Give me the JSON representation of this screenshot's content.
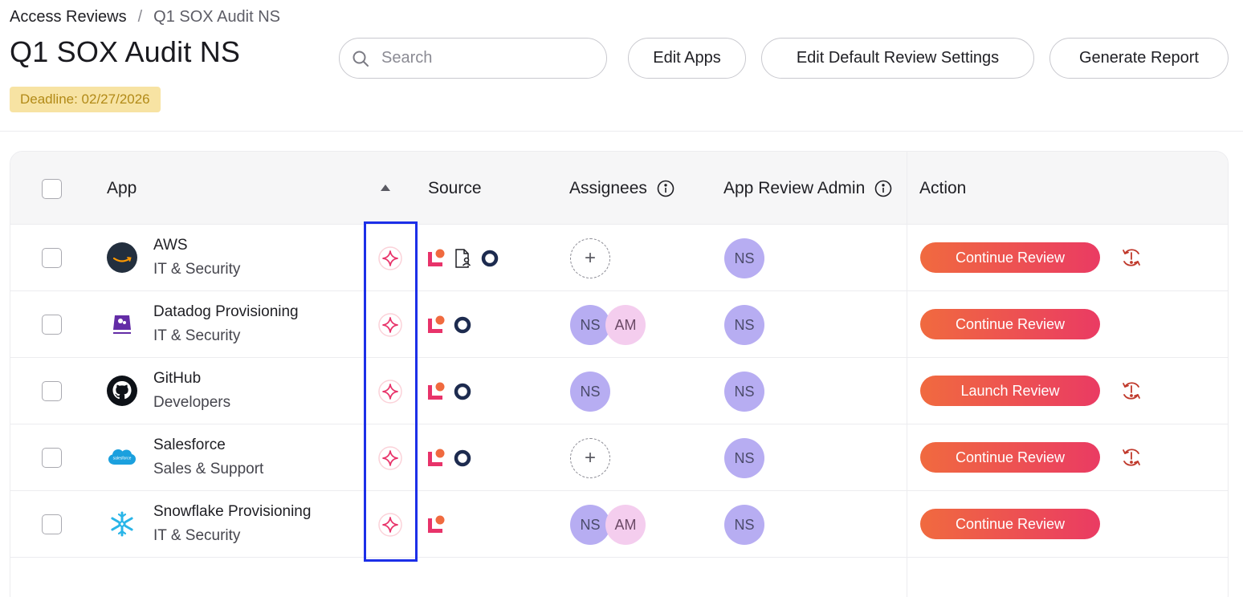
{
  "breadcrumb": {
    "root": "Access Reviews",
    "separator": "/",
    "current": "Q1 SOX Audit NS"
  },
  "page": {
    "title": "Q1 SOX Audit NS",
    "deadline": "Deadline: 02/27/2026"
  },
  "search": {
    "placeholder": "Search",
    "value": ""
  },
  "toolbar": {
    "edit_apps": "Edit Apps",
    "edit_default_settings": "Edit Default Review Settings",
    "generate_report": "Generate Report"
  },
  "table": {
    "headers": {
      "app": "App",
      "source": "Source",
      "assignees": "Assignees",
      "admin": "App Review Admin",
      "action": "Action"
    },
    "sort": "ascending",
    "rows": [
      {
        "app": "AWS",
        "category": "IT & Security",
        "logo": "aws-logo",
        "sources": [
          "lumos-icon",
          "user-document-icon",
          "ring-icon"
        ],
        "assignees": [],
        "admin": "NS",
        "action": "Continue Review",
        "warning": true
      },
      {
        "app": "Datadog Provisioning",
        "category": "IT & Security",
        "logo": "datadog-logo",
        "sources": [
          "lumos-icon",
          "ring-icon"
        ],
        "assignees": [
          "NS",
          "AM"
        ],
        "admin": "NS",
        "action": "Continue Review",
        "warning": false
      },
      {
        "app": "GitHub",
        "category": "Developers",
        "logo": "github-logo",
        "sources": [
          "lumos-icon",
          "ring-icon"
        ],
        "assignees": [
          "NS"
        ],
        "admin": "NS",
        "action": "Launch Review",
        "warning": true
      },
      {
        "app": "Salesforce",
        "category": "Sales & Support",
        "logo": "salesforce-logo",
        "sources": [
          "lumos-icon",
          "ring-icon"
        ],
        "assignees": [],
        "admin": "NS",
        "action": "Continue Review",
        "warning": true
      },
      {
        "app": "Snowflake Provisioning",
        "category": "IT & Security",
        "logo": "snowflake-logo",
        "sources": [
          "lumos-icon"
        ],
        "assignees": [
          "NS",
          "AM"
        ],
        "admin": "NS",
        "action": "Continue Review",
        "warning": false
      }
    ]
  },
  "colors": {
    "accent_gradient_start": "#f06a3f",
    "accent_gradient_end": "#ea3b63",
    "deadline_bg": "#f7e3a3",
    "deadline_text": "#b28a17",
    "highlight": "#1c2fe8",
    "avatar_ns": "#b7adf2",
    "avatar_am": "#f4cdee",
    "warning": "#c0392b"
  }
}
